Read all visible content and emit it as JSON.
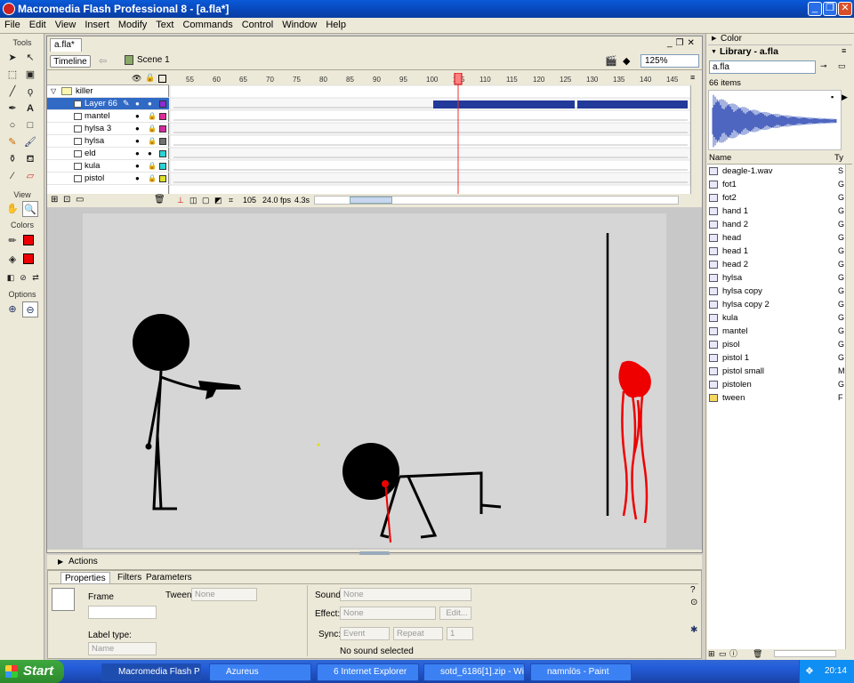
{
  "window": {
    "title": "Macromedia Flash Professional 8 - [a.fla*]",
    "min": "_",
    "restore": "❐",
    "close": "✕"
  },
  "menu": [
    "File",
    "Edit",
    "View",
    "Insert",
    "Modify",
    "Text",
    "Commands",
    "Control",
    "Window",
    "Help"
  ],
  "tools": {
    "label": "Tools",
    "view_label": "View",
    "colors_label": "Colors",
    "options_label": "Options"
  },
  "doc": {
    "tab": "a.fla*",
    "timeline_btn": "Timeline",
    "scene": "Scene 1",
    "zoom": "125%"
  },
  "timeline": {
    "ruler": [
      "55",
      "60",
      "65",
      "70",
      "75",
      "80",
      "85",
      "90",
      "95",
      "100",
      "105",
      "110",
      "115",
      "120",
      "125",
      "130",
      "135",
      "140",
      "145"
    ],
    "layers": [
      {
        "name": "killer",
        "type": "folder",
        "color": ""
      },
      {
        "name": "Layer 66",
        "type": "layer",
        "color": "#8e2ad0",
        "selected": true
      },
      {
        "name": "mantel",
        "type": "layer",
        "color": "#e0299a"
      },
      {
        "name": "hylsa 3",
        "type": "layer",
        "color": "#d42a9e"
      },
      {
        "name": "hylsa",
        "type": "layer",
        "color": "#707070"
      },
      {
        "name": "eld",
        "type": "layer",
        "color": "#2ad4d4"
      },
      {
        "name": "kula",
        "type": "layer",
        "color": "#2ad4d4"
      },
      {
        "name": "pistol",
        "type": "layer",
        "color": "#e0e02a"
      }
    ],
    "frame": "105",
    "fps": "24.0 fps",
    "time": "4.3s"
  },
  "panels": {
    "actions": "Actions",
    "properties_tab": "Properties",
    "filters_tab": "Filters",
    "parameters_tab": "Parameters"
  },
  "properties": {
    "frame_label": "Frame",
    "tween_label": "Tween:",
    "tween_value": "None",
    "label_type": "Label type:",
    "label_type_value": "Name",
    "sound_label": "Sound:",
    "sound_value": "None",
    "effect_label": "Effect:",
    "effect_value": "None",
    "edit_btn": "Edit...",
    "sync_label": "Sync:",
    "sync_value": "Event",
    "repeat_value": "Repeat",
    "repeat_count": "1",
    "no_sound": "No sound selected"
  },
  "color_panel": {
    "title": "Color"
  },
  "library": {
    "title": "Library - a.fla",
    "selector": "a.fla",
    "count": "66 items",
    "col_name": "Name",
    "col_type": "Ty",
    "items": [
      {
        "name": "deagle-1.wav",
        "type": "S"
      },
      {
        "name": "fot1",
        "type": "G"
      },
      {
        "name": "fot2",
        "type": "G"
      },
      {
        "name": "hand 1",
        "type": "G"
      },
      {
        "name": "hand 2",
        "type": "G"
      },
      {
        "name": "head",
        "type": "G"
      },
      {
        "name": "head 1",
        "type": "G"
      },
      {
        "name": "head 2",
        "type": "G"
      },
      {
        "name": "hylsa",
        "type": "G"
      },
      {
        "name": "hylsa copy",
        "type": "G"
      },
      {
        "name": "hylsa copy 2",
        "type": "G"
      },
      {
        "name": "kula",
        "type": "G"
      },
      {
        "name": "mantel",
        "type": "G"
      },
      {
        "name": "pisol",
        "type": "G"
      },
      {
        "name": "pistol 1",
        "type": "G"
      },
      {
        "name": "pistol small",
        "type": "M"
      },
      {
        "name": "pistolen",
        "type": "G"
      },
      {
        "name": "tween",
        "type": "F"
      }
    ]
  },
  "taskbar": {
    "start": "Start",
    "tasks": [
      "Macromedia Flash Pro...",
      "Azureus",
      "6 Internet Explorer",
      "sotd_6186[1].zip - Wi...",
      "namnlös - Paint"
    ],
    "clock": "20:14"
  }
}
